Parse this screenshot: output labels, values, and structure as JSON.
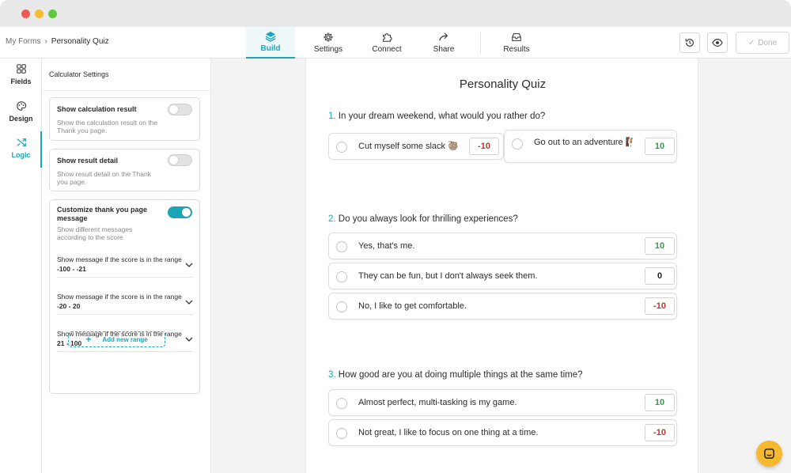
{
  "window": {
    "colors": {
      "close": "#ee5a52",
      "minimize": "#f5bd2f",
      "maximize": "#5dc840"
    }
  },
  "breadcrumb": {
    "root": "My Forms",
    "separator": "›",
    "current": "Personality Quiz"
  },
  "nav": {
    "build": "Build",
    "settings": "Settings",
    "connect": "Connect",
    "share": "Share",
    "results": "Results",
    "done": "Done"
  },
  "rail": {
    "fields": "Fields",
    "design": "Design",
    "logic": "Logic"
  },
  "panel": {
    "title": "Calculator Settings",
    "show_result": {
      "title": "Show calculation result",
      "desc": "Show the calculation result on the Thank you page.",
      "enabled": false
    },
    "show_detail": {
      "title": "Show result detail",
      "desc": "Show result detail on the Thank you page.",
      "enabled": false
    },
    "customize": {
      "title": "Customize thank you page message",
      "desc": "Show different messages according to the score",
      "enabled": true
    },
    "range_prefix": "Show message if the score is in the range",
    "ranges": [
      "-100 - -21",
      "-20 - 20",
      "21 - 100"
    ],
    "add_range": "Add new range"
  },
  "form": {
    "title": "Personality Quiz",
    "questions": [
      {
        "number": "1.",
        "text": "In your dream weekend, what would you rather do?",
        "options": [
          {
            "label": "Cut myself some slack 🦥",
            "score": "-10"
          },
          {
            "label": "Go out to an adventure 🧗",
            "score": "10"
          }
        ]
      },
      {
        "number": "2.",
        "text": "Do you always look for thrilling experiences?",
        "options": [
          {
            "label": "Yes, that's me.",
            "score": "10"
          },
          {
            "label": "They can be fun, but I don't always seek them.",
            "score": "0"
          },
          {
            "label": "No, I like to get comfortable.",
            "score": "-10"
          }
        ]
      },
      {
        "number": "3.",
        "text": "How good are you at doing multiple things at the same time?",
        "options": [
          {
            "label": "Almost perfect, multi-tasking is my game.",
            "score": "10"
          },
          {
            "label": "Not great, I like to focus on one thing at a time.",
            "score": "-10"
          }
        ]
      }
    ]
  },
  "colors": {
    "accent": "#1aa6b7",
    "positive": "#2aa04a",
    "negative": "#c0322b",
    "chat": "#f5b82e"
  }
}
